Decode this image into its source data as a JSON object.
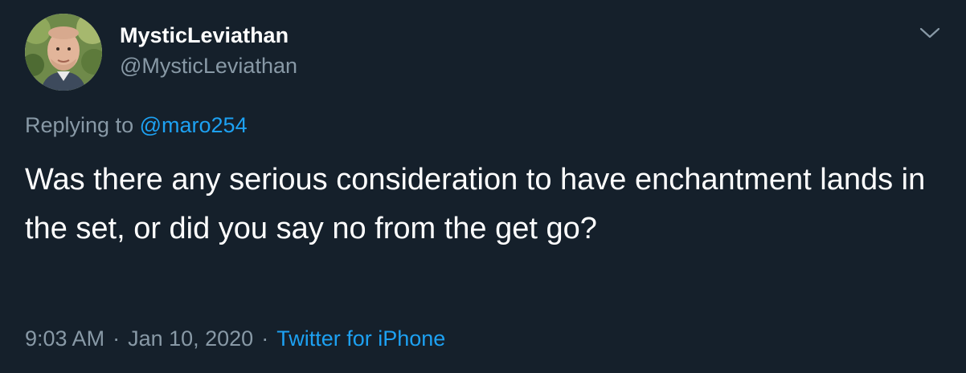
{
  "author": {
    "display_name": "MysticLeviathan",
    "handle": "@MysticLeviathan",
    "avatar_icon": "user-photo-avatar"
  },
  "reply": {
    "prefix": "Replying to",
    "mention": "@maro254"
  },
  "tweet": {
    "text": "Was there any serious consideration to have enchantment lands in the set, or did you say no from the get go?"
  },
  "meta": {
    "time": "9:03 AM",
    "separator": "·",
    "date": "Jan 10, 2020",
    "source": "Twitter for iPhone"
  },
  "icons": {
    "more": "chevron-down-icon"
  },
  "colors": {
    "background": "#15202b",
    "text": "#ffffff",
    "muted": "#8899a6",
    "link": "#1da1f2"
  }
}
